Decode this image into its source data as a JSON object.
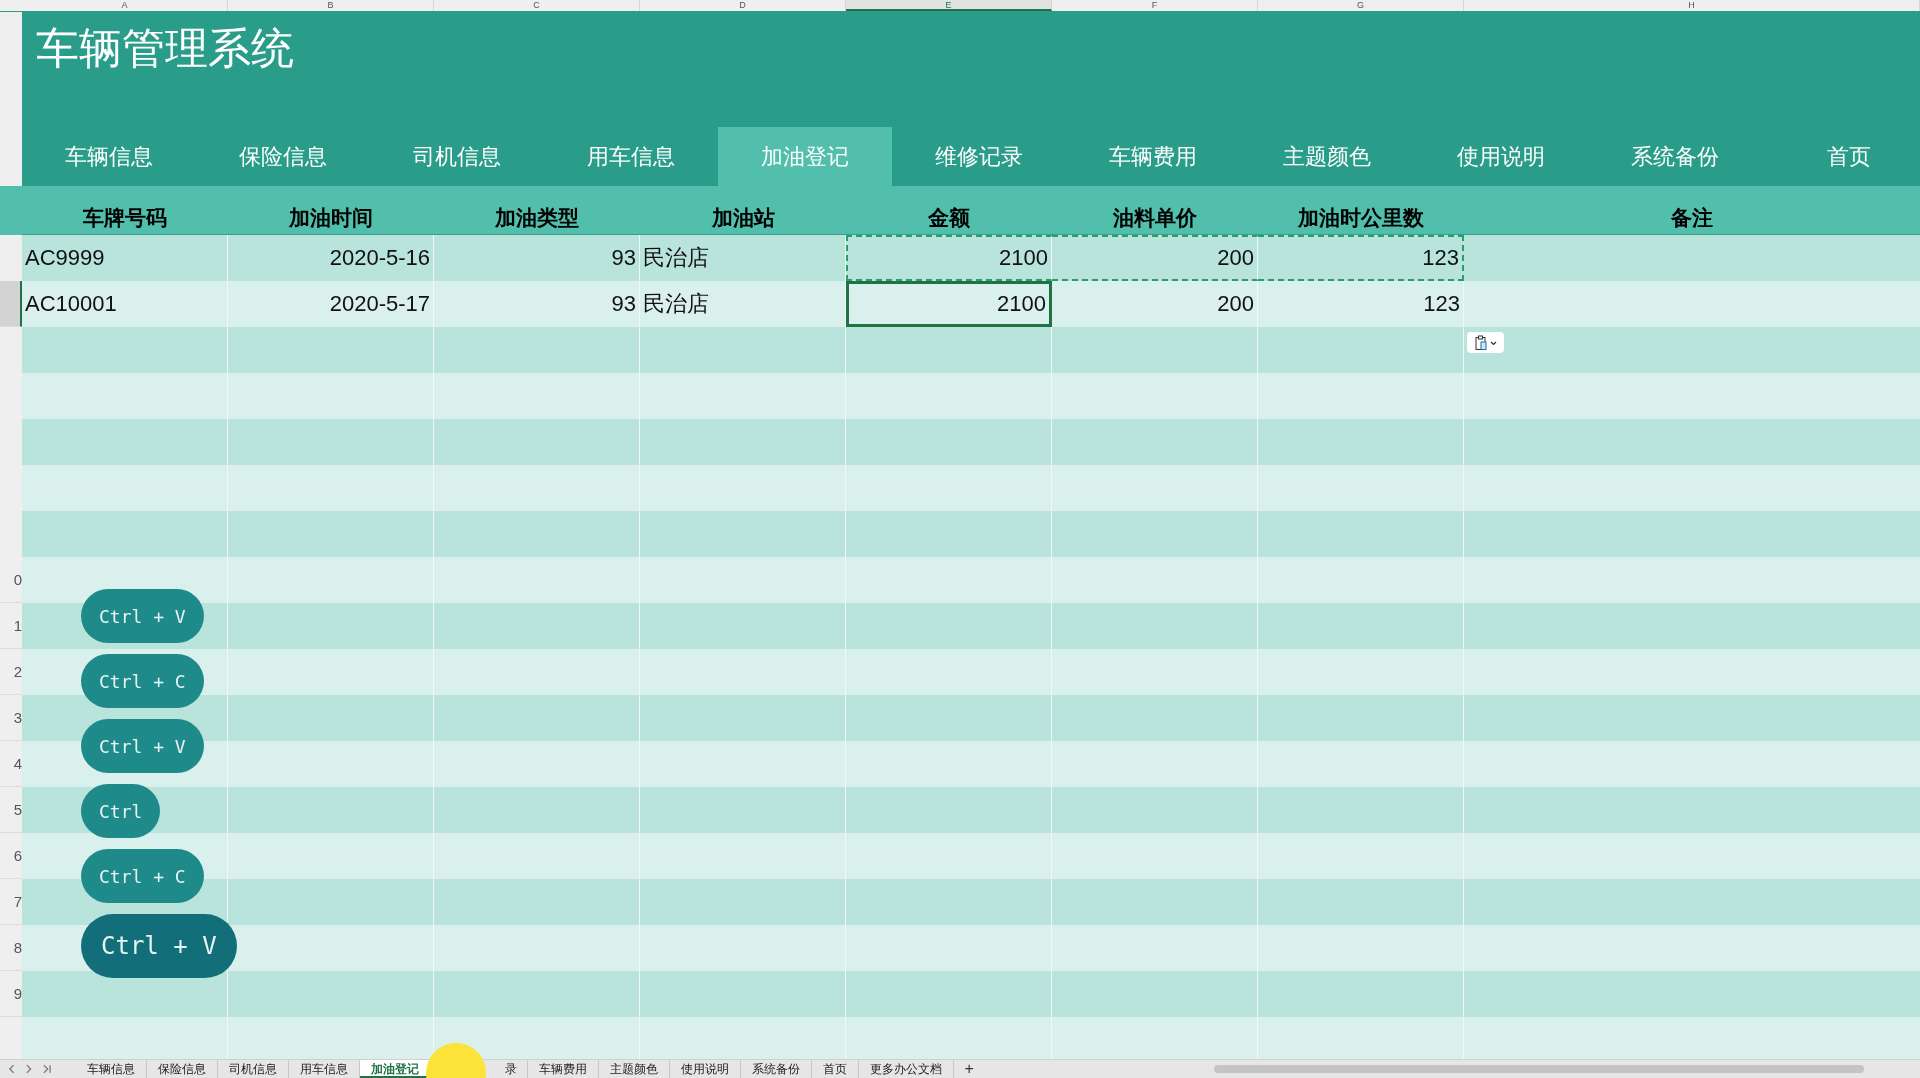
{
  "column_headers": [
    {
      "label": "A",
      "selected": false
    },
    {
      "label": "B",
      "selected": false
    },
    {
      "label": "C",
      "selected": false
    },
    {
      "label": "D",
      "selected": false
    },
    {
      "label": "E",
      "selected": true
    },
    {
      "label": "F",
      "selected": false
    },
    {
      "label": "G",
      "selected": false
    },
    {
      "label": "H",
      "selected": false
    }
  ],
  "banner": {
    "title": "车辆管理系统"
  },
  "nav": [
    {
      "label": "车辆信息",
      "selected": false
    },
    {
      "label": "保险信息",
      "selected": false
    },
    {
      "label": "司机信息",
      "selected": false
    },
    {
      "label": "用车信息",
      "selected": false
    },
    {
      "label": "加油登记",
      "selected": true
    },
    {
      "label": "维修记录",
      "selected": false
    },
    {
      "label": "车辆费用",
      "selected": false
    },
    {
      "label": "主题颜色",
      "selected": false
    },
    {
      "label": "使用说明",
      "selected": false
    },
    {
      "label": "系统备份",
      "selected": false
    },
    {
      "label": "首页",
      "selected": false
    }
  ],
  "table": {
    "columns": [
      "车牌号码",
      "加油时间",
      "加油类型",
      "加油站",
      "金额",
      "油料单价",
      "加油时公里数",
      "备注"
    ],
    "rows": [
      {
        "selected": false,
        "cells": [
          {
            "text": "AC9999",
            "active": false,
            "copied": false
          },
          {
            "text": "2020-5-16",
            "active": false,
            "copied": false
          },
          {
            "text": "93",
            "active": false,
            "copied": false
          },
          {
            "text": "民治店",
            "active": false,
            "copied": false
          },
          {
            "text": "2100",
            "active": false,
            "copied": true
          },
          {
            "text": "200",
            "active": false,
            "copied": true
          },
          {
            "text": "123",
            "active": false,
            "copied": true
          },
          {
            "text": "",
            "active": false,
            "copied": false
          }
        ]
      },
      {
        "selected": true,
        "cells": [
          {
            "text": "AC10001",
            "active": false,
            "copied": false
          },
          {
            "text": "2020-5-17",
            "active": false,
            "copied": false
          },
          {
            "text": "93",
            "active": false,
            "copied": false
          },
          {
            "text": "民治店",
            "active": false,
            "copied": false
          },
          {
            "text": "2100",
            "active": true,
            "copied": false
          },
          {
            "text": "200",
            "active": false,
            "copied": false
          },
          {
            "text": "123",
            "active": false,
            "copied": false
          },
          {
            "text": "",
            "active": false,
            "copied": false
          }
        ]
      },
      {
        "selected": false,
        "paste_options": true
      },
      {
        "selected": false
      },
      {
        "selected": false
      },
      {
        "selected": false
      },
      {
        "selected": false
      },
      {
        "selected": false,
        "row_label": "0"
      },
      {
        "selected": false,
        "row_label": "1"
      },
      {
        "selected": false,
        "row_label": "2"
      },
      {
        "selected": false,
        "row_label": "3"
      },
      {
        "selected": false,
        "row_label": "4"
      },
      {
        "selected": false,
        "row_label": "5"
      },
      {
        "selected": false,
        "row_label": "6"
      },
      {
        "selected": false,
        "row_label": "7"
      },
      {
        "selected": false,
        "row_label": "8"
      },
      {
        "selected": false,
        "row_label": "9"
      },
      {
        "selected": false
      }
    ]
  },
  "keystrokes": [
    {
      "keys": "Ctrl + V",
      "kind": "normal"
    },
    {
      "keys": "Ctrl + C",
      "kind": "normal"
    },
    {
      "keys": "Ctrl + V",
      "kind": "normal"
    },
    {
      "keys": "Ctrl",
      "kind": "normal"
    },
    {
      "keys": "Ctrl + C",
      "kind": "normal"
    },
    {
      "keys": "Ctrl + V",
      "kind": "large"
    }
  ],
  "sheet_tabs": [
    {
      "label": "车辆信息",
      "selected": false
    },
    {
      "label": "保险信息",
      "selected": false
    },
    {
      "label": "司机信息",
      "selected": false
    },
    {
      "label": "用车信息",
      "selected": false
    },
    {
      "label": "加油登记",
      "selected": true
    },
    {
      "label": "录",
      "selected": false
    },
    {
      "label": "车辆费用",
      "selected": false
    },
    {
      "label": "主题颜色",
      "selected": false
    },
    {
      "label": "使用说明",
      "selected": false
    },
    {
      "label": "系统备份",
      "selected": false
    },
    {
      "label": "首页",
      "selected": false
    },
    {
      "label": "更多办公文档",
      "selected": false
    }
  ],
  "add_sheet": "+"
}
